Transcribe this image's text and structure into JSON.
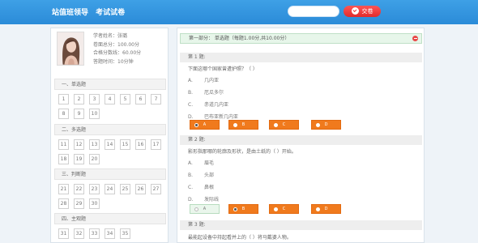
{
  "header": {
    "brand": "站值班领导",
    "title": "考试试卷",
    "search_placeholder": "",
    "submit_label": "交卷"
  },
  "profile": {
    "name_line": "学者姓名：张璐",
    "total_line": "卷面总分：100.00分",
    "pass_line": "合格分数线：60.00分",
    "time_line": "答题时间：10分钟"
  },
  "sections": [
    {
      "title": "一、单选题",
      "numbers": [
        "1",
        "2",
        "3",
        "4",
        "5",
        "6",
        "7",
        "8",
        "9",
        "10"
      ]
    },
    {
      "title": "二、多选题",
      "numbers": [
        "11",
        "12",
        "13",
        "14",
        "15",
        "16",
        "17",
        "18",
        "19",
        "20"
      ]
    },
    {
      "title": "三、判断题",
      "numbers": [
        "21",
        "22",
        "23",
        "24",
        "25",
        "26",
        "27",
        "28",
        "29",
        "30"
      ]
    },
    {
      "title": "四、主观题",
      "numbers": [
        "31",
        "32",
        "33",
        "34",
        "35"
      ]
    }
  ],
  "part": {
    "label": "第一部分：  单选题（每题1.00分,共10.00分）"
  },
  "questions": [
    {
      "header": "第 1 题:",
      "text": "下面这哪个国家曾遭护照？（  ）",
      "options": [
        {
          "letter": "A.",
          "text": "几内亚"
        },
        {
          "letter": "B.",
          "text": "厄瓜多尔"
        },
        {
          "letter": "C.",
          "text": "赤道几内亚"
        },
        {
          "letter": "D.",
          "text": "巴布亚新几内亚"
        }
      ],
      "choices": [
        "A",
        "B",
        "C",
        "D"
      ],
      "selected": "A"
    },
    {
      "header": "第 2 题:",
      "text": "影形指那哪的轮廓及形状，是由土纸的（   ）开始。",
      "options": [
        {
          "letter": "A.",
          "text": "眉毛"
        },
        {
          "letter": "B.",
          "text": "头部"
        },
        {
          "letter": "C.",
          "text": "鼻根"
        },
        {
          "letter": "D.",
          "text": "发际线"
        }
      ],
      "choices": [
        "A",
        "B",
        "C",
        "D"
      ],
      "selected": "B"
    },
    {
      "header": "第 3 题:",
      "text": "最能起设备中持起看并上的（  ）将马戴婆人物。"
    }
  ],
  "colors": {
    "accent": "#2b8bd8",
    "submit": "#e02b2b",
    "choice": "#f07a1d",
    "part_bg": "#e7f6ea"
  }
}
